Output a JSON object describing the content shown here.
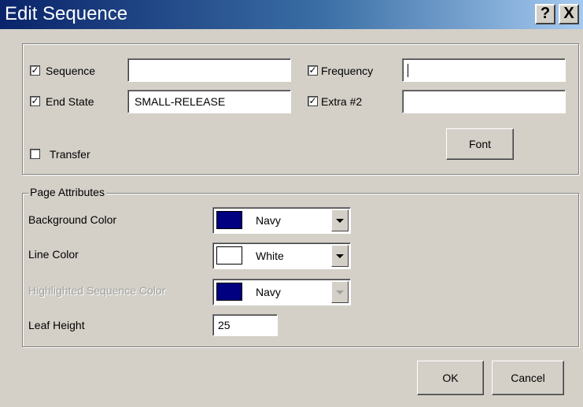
{
  "window": {
    "title": "Edit Sequence",
    "help_label": "?",
    "close_label": "X"
  },
  "fields": {
    "sequence": {
      "label": "Sequence",
      "checked": true,
      "value": ""
    },
    "end_state": {
      "label": "End State",
      "checked": true,
      "value": "SMALL-RELEASE"
    },
    "frequency": {
      "label": "Frequency",
      "checked": true,
      "value": ""
    },
    "extra2": {
      "label": "Extra #2",
      "checked": true,
      "value": ""
    },
    "transfer": {
      "label": "Transfer",
      "checked": false
    }
  },
  "font_button": "Font",
  "page_attributes": {
    "legend": "Page Attributes",
    "background_color": {
      "label": "Background Color",
      "value": "Navy",
      "swatch": "#000080"
    },
    "line_color": {
      "label": "Line Color",
      "value": "White",
      "swatch": "#ffffff"
    },
    "highlighted_sequence_color": {
      "label": "Highlighted Sequence Color",
      "value": "Navy",
      "swatch": "#000080",
      "disabled": true
    },
    "leaf_height": {
      "label": "Leaf Height",
      "value": "25"
    }
  },
  "buttons": {
    "ok": "OK",
    "cancel": "Cancel"
  }
}
